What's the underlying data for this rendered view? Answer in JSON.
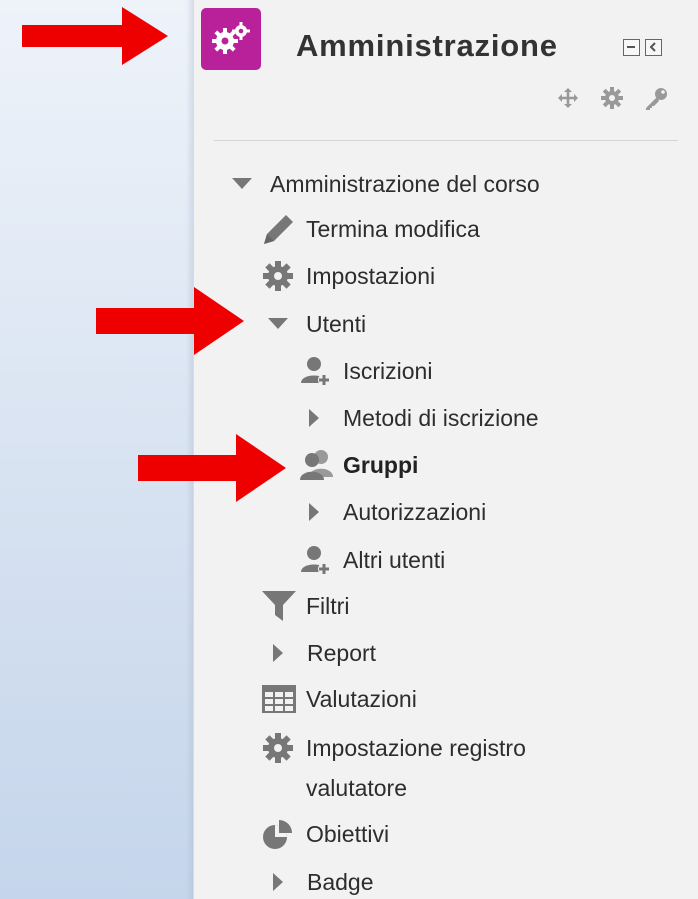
{
  "block": {
    "title": "Amministrazione",
    "icon": "cogs-icon",
    "accent_color": "#b8219a"
  },
  "tree": {
    "course_admin": "Amministrazione del corso",
    "termina_modifica": "Termina modifica",
    "impostazioni": "Impostazioni",
    "utenti": "Utenti",
    "iscrizioni": "Iscrizioni",
    "metodi_iscrizione": "Metodi di iscrizione",
    "gruppi": "Gruppi",
    "autorizzazioni": "Autorizzazioni",
    "altri_utenti": "Altri utenti",
    "filtri": "Filtri",
    "report": "Report",
    "valutazioni": "Valutazioni",
    "impostazione_registro_1": "Impostazione registro",
    "impostazione_registro_2": "valutatore",
    "obiettivi": "Obiettivi",
    "badge": "Badge"
  },
  "annotation_color": "#ee0000"
}
